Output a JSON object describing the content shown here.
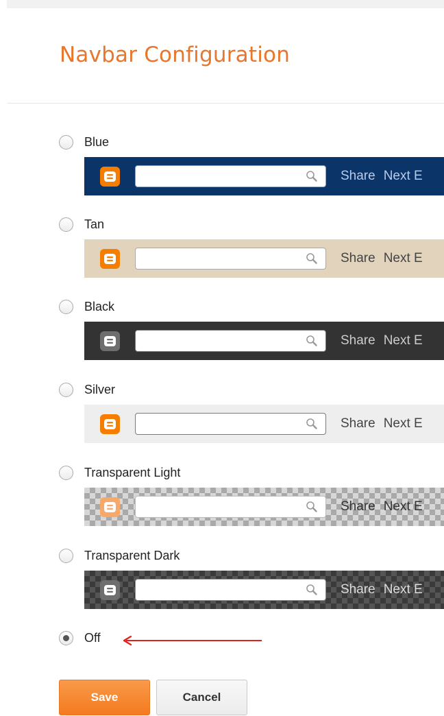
{
  "page": {
    "title": "Navbar Configuration"
  },
  "options": [
    {
      "label": "Blue",
      "selected": false
    },
    {
      "label": "Tan",
      "selected": false
    },
    {
      "label": "Black",
      "selected": false
    },
    {
      "label": "Silver",
      "selected": false
    },
    {
      "label": "Transparent Light",
      "selected": false
    },
    {
      "label": "Transparent Dark",
      "selected": false
    },
    {
      "label": "Off",
      "selected": true
    }
  ],
  "preview": {
    "share": "Share",
    "next": "Next E"
  },
  "icons": {
    "logo": "blogger-logo-icon",
    "search": "magnifier-icon",
    "arrow": "red-arrow-icon"
  },
  "colors": {
    "accent": "#e8762c",
    "save": "#f47a1f",
    "arrow": "#e0201b"
  },
  "buttons": {
    "save": "Save",
    "cancel": "Cancel"
  }
}
